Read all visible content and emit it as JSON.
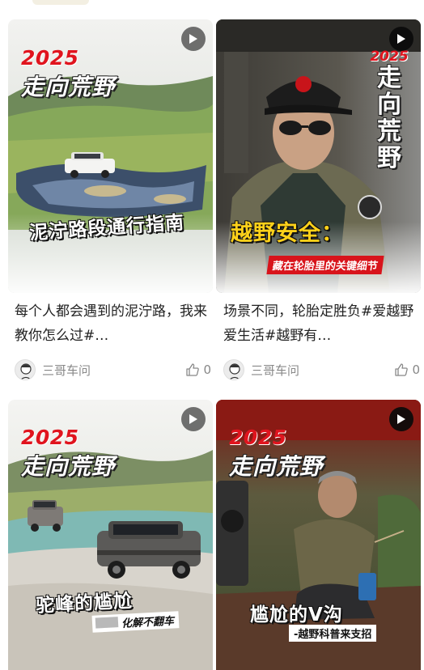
{
  "feed": [
    {
      "brand_year": "2025",
      "brand_slogan": "走向荒野",
      "cover_title": "泥泞路段通行指南",
      "cover_subtitle": "",
      "caption": "每个人都会遇到的泥泞路，我来教你怎么过#…",
      "author": "三哥车问",
      "likes": "0",
      "play_icon": "play-icon"
    },
    {
      "brand_year": "2025",
      "brand_slogan": "走向荒野",
      "cover_title": "越野安全：",
      "cover_subtitle": "藏在轮胎里的关键细节",
      "caption": "场景不同，轮胎定胜负#爱越野爱生活#越野有…",
      "author": "三哥车问",
      "likes": "0",
      "play_icon": "play-icon"
    },
    {
      "brand_year": "2025",
      "brand_slogan": "走向荒野",
      "cover_title": "驼峰的尴尬",
      "cover_subtitle": "化解不翻车",
      "caption": "",
      "author": "",
      "likes": "",
      "play_icon": "play-icon"
    },
    {
      "brand_year": "2025",
      "brand_slogan": "走向荒野",
      "cover_title": "尴尬的V沟",
      "cover_subtitle": "-越野科普来支招",
      "caption": "",
      "author": "",
      "likes": "",
      "play_icon": "play-icon"
    }
  ],
  "colors": {
    "brand_red": "#e0141e",
    "meta_gray": "#888888",
    "caption_text": "#222222"
  }
}
